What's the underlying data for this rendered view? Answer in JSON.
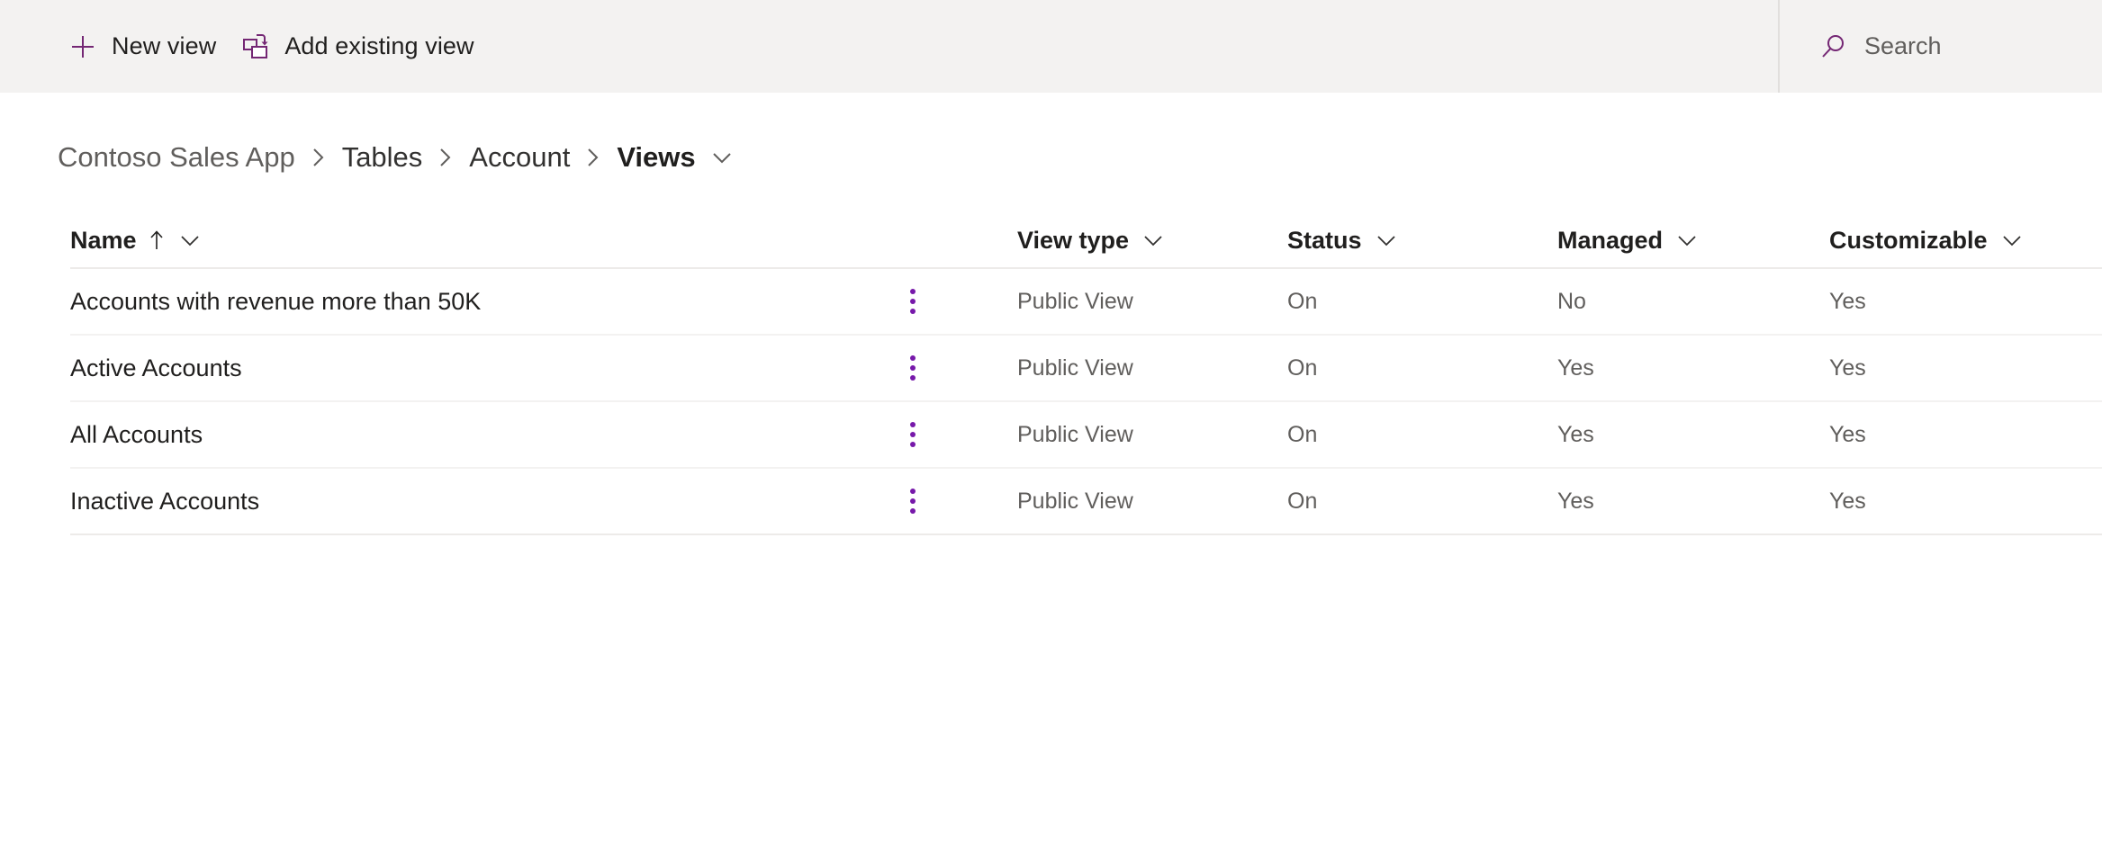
{
  "commandbar": {
    "buttons": [
      {
        "label": "New view",
        "icon": "plus-icon"
      },
      {
        "label": "Add existing view",
        "icon": "add-existing-view-icon"
      }
    ],
    "search": {
      "icon": "search-icon",
      "placeholder": "Search",
      "value": ""
    },
    "background": "#f3f2f1",
    "accent": "#742774"
  },
  "breadcrumb": {
    "separator": "›",
    "items": [
      {
        "label": "Contoso Sales App",
        "current": false,
        "muted": true
      },
      {
        "label": "Tables",
        "current": false,
        "muted": false
      },
      {
        "label": "Account",
        "current": false,
        "muted": false
      },
      {
        "label": "Views",
        "current": true,
        "muted": false
      }
    ],
    "caret_icon": "chevron-down-icon"
  },
  "table": {
    "columns": [
      {
        "key": "name",
        "label": "Name",
        "sorted": "ascending",
        "sort_icon": "arrow-up-icon",
        "caret_icon": "chevron-down-icon"
      },
      {
        "key": "view_type",
        "label": "View type",
        "sorted": "none",
        "caret_icon": "chevron-down-icon"
      },
      {
        "key": "status",
        "label": "Status",
        "sorted": "none",
        "caret_icon": "chevron-down-icon"
      },
      {
        "key": "managed",
        "label": "Managed",
        "sorted": "none",
        "caret_icon": "chevron-down-icon"
      },
      {
        "key": "customizable",
        "label": "Customizable",
        "sorted": "none",
        "caret_icon": "chevron-down-icon"
      }
    ],
    "row_menu_icon": "more-vertical-icon",
    "rows": [
      {
        "name": "Accounts with revenue more than 50K",
        "view_type": "Public View",
        "status": "On",
        "managed": "No",
        "customizable": "Yes"
      },
      {
        "name": "Active Accounts",
        "view_type": "Public View",
        "status": "On",
        "managed": "Yes",
        "customizable": "Yes"
      },
      {
        "name": "All Accounts",
        "view_type": "Public View",
        "status": "On",
        "managed": "Yes",
        "customizable": "Yes"
      },
      {
        "name": "Inactive Accounts",
        "view_type": "Public View",
        "status": "On",
        "managed": "Yes",
        "customizable": "Yes"
      }
    ]
  }
}
